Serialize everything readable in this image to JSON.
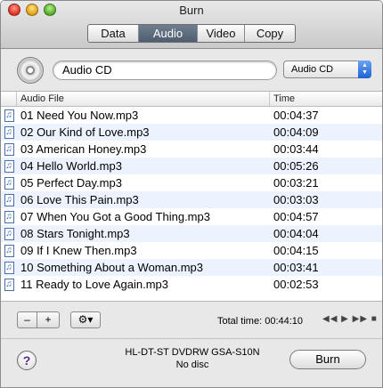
{
  "window": {
    "title": "Burn"
  },
  "tabs": [
    {
      "label": "Data",
      "active": false
    },
    {
      "label": "Audio",
      "active": true
    },
    {
      "label": "Video",
      "active": false
    },
    {
      "label": "Copy",
      "active": false
    }
  ],
  "disc_name": {
    "value": "Audio CD"
  },
  "disc_type": {
    "selected": "Audio CD"
  },
  "table": {
    "columns": [
      "Audio File",
      "Time"
    ],
    "rows": [
      {
        "file": "01 Need You Now.mp3",
        "time": "00:04:37"
      },
      {
        "file": "02 Our Kind of Love.mp3",
        "time": "00:04:09"
      },
      {
        "file": "03 American Honey.mp3",
        "time": "00:03:44"
      },
      {
        "file": "04 Hello World.mp3",
        "time": "00:05:26"
      },
      {
        "file": "05 Perfect Day.mp3",
        "time": "00:03:21"
      },
      {
        "file": "06 Love This Pain.mp3",
        "time": "00:03:03"
      },
      {
        "file": "07 When You Got a Good Thing.mp3",
        "time": "00:04:57"
      },
      {
        "file": "08 Stars Tonight.mp3",
        "time": "00:04:04"
      },
      {
        "file": "09 If I Knew Then.mp3",
        "time": "00:04:15"
      },
      {
        "file": "10 Something About a Woman.mp3",
        "time": "00:03:41"
      },
      {
        "file": "11 Ready to Love Again.mp3",
        "time": "00:02:53"
      }
    ]
  },
  "controls": {
    "remove_label": "–",
    "add_label": "+",
    "action_label": "⚙▾",
    "total_time_label": "Total time:",
    "total_time_value": "00:44:10",
    "transport_label": "◀◀ ▶ ▶▶ ■"
  },
  "drive": {
    "name": "HL-DT-ST DVDRW GSA-S10N",
    "status": "No disc"
  },
  "footer": {
    "help_label": "?",
    "burn_label": "Burn"
  },
  "icons": {
    "track": "music-note-icon",
    "disc": "cd-disc-icon",
    "gear": "gear-icon"
  }
}
